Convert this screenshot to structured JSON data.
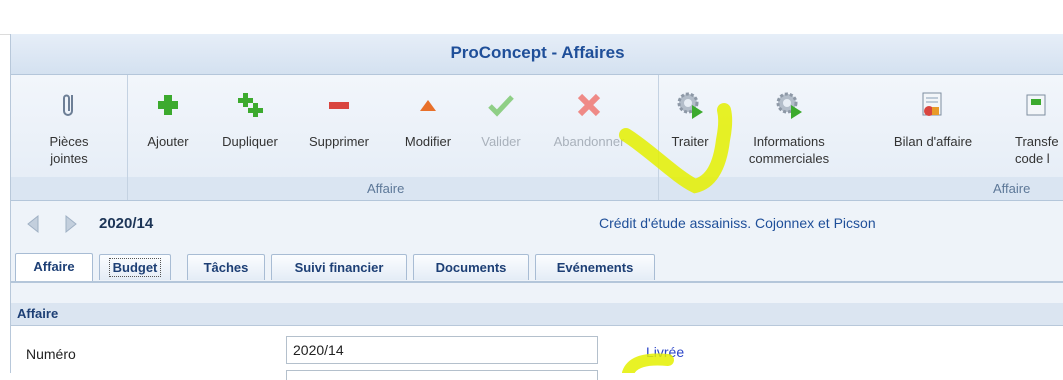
{
  "window": {
    "title": "ProConcept - Affaires"
  },
  "ribbon": {
    "attachments": {
      "label": "Pièces\njointes",
      "icon": "paperclip-icon"
    },
    "affaire_group": {
      "label": "Affaire",
      "buttons": [
        {
          "label": "Ajouter",
          "icon": "add-icon",
          "enabled": true
        },
        {
          "label": "Dupliquer",
          "icon": "duplicate-icon",
          "enabled": true
        },
        {
          "label": "Supprimer",
          "icon": "delete-icon",
          "enabled": true
        },
        {
          "label": "Modifier",
          "icon": "edit-icon",
          "enabled": true
        },
        {
          "label": "Valider",
          "icon": "validate-check-icon",
          "enabled": false
        },
        {
          "label": "Abandonner",
          "icon": "abandon-x-icon",
          "enabled": false
        }
      ]
    },
    "actions_group": {
      "label": "Affaire",
      "buttons": [
        {
          "label": "Traiter",
          "icon": "process-gear-icon"
        },
        {
          "label": "Informations\ncommerciales",
          "icon": "commercial-info-gear-icon"
        },
        {
          "label": "Bilan d'affaire",
          "icon": "balance-report-icon"
        },
        {
          "label": "Transfe\ncode l",
          "icon": "transfer-icon"
        }
      ]
    }
  },
  "record": {
    "number": "2020/14",
    "description": "Crédit d'étude assainiss. Cojonnex et Picson"
  },
  "tabs": [
    {
      "label": "Affaire",
      "active": true
    },
    {
      "label": "Budget",
      "focused": true
    },
    {
      "label": "Tâches"
    },
    {
      "label": "Suivi financier"
    },
    {
      "label": "Documents"
    },
    {
      "label": "Evénements"
    }
  ],
  "section": {
    "title": "Affaire"
  },
  "form": {
    "numero_label": "Numéro",
    "numero_value": "2020/14",
    "status": "Livrée"
  },
  "colors": {
    "title_text": "#1f4f99",
    "tab_text": "#1d3f75",
    "status_link": "#2a44c8",
    "highlight_annotation": "#e4f000"
  }
}
